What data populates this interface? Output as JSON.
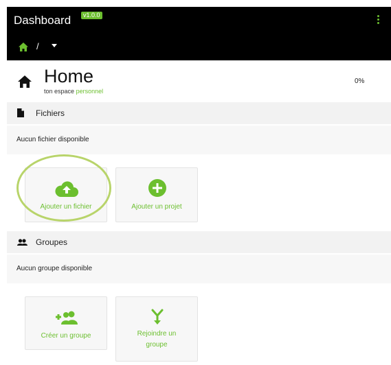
{
  "app": {
    "title": "Dashboard",
    "version": "v1.0.0"
  },
  "breadcrumb": {
    "separator": "/"
  },
  "page": {
    "title": "Home",
    "subtitle_prefix": "ton espace",
    "subtitle_accent": "personnel",
    "progress": "0%"
  },
  "files": {
    "heading": "Fichiers",
    "empty_text": "Aucun fichier disponible",
    "actions": [
      {
        "label": "Ajouter un fichier",
        "icon": "cloud-upload-icon"
      },
      {
        "label": "Ajouter un projet",
        "icon": "plus-circle-icon"
      }
    ]
  },
  "groups": {
    "heading": "Groupes",
    "empty_text": "Aucun groupe disponible",
    "actions": [
      {
        "label": "Créer un groupe",
        "icon": "add-group-icon"
      },
      {
        "label": "Rejoindre un groupe",
        "icon": "merge-icon"
      }
    ]
  },
  "colors": {
    "accent": "#6cbf2f",
    "topbar": "#000000",
    "section_bg": "#f2f2f2",
    "highlight": "#b8d46a"
  }
}
